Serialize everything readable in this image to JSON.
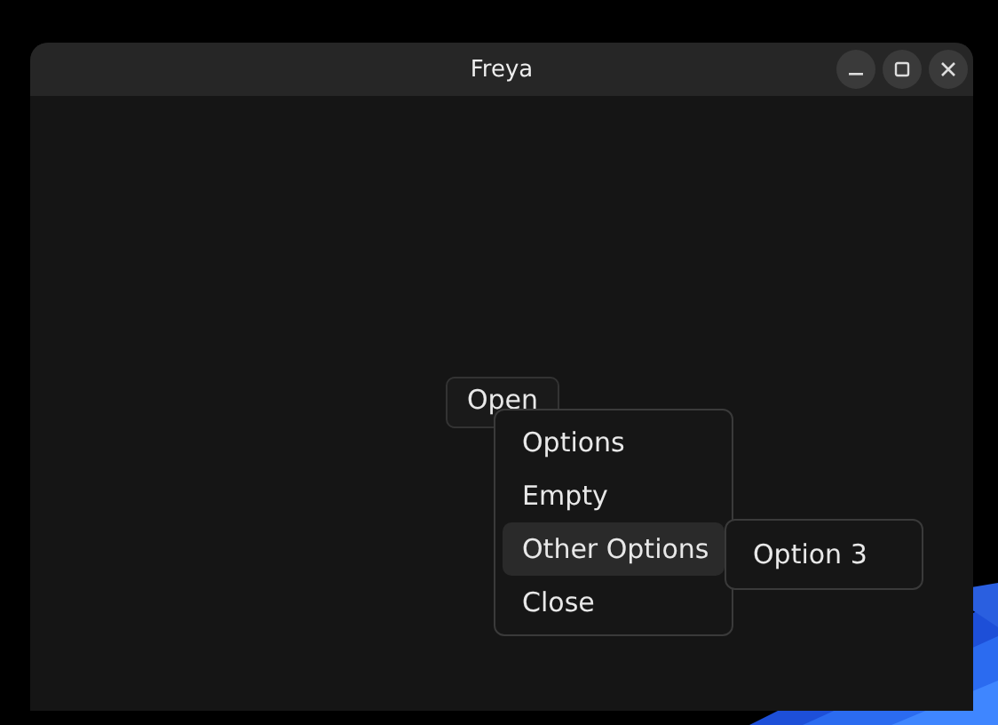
{
  "window": {
    "title": "Freya"
  },
  "open_button": {
    "label": "Open"
  },
  "menu": {
    "items": [
      {
        "label": "Options",
        "selected": false
      },
      {
        "label": "Empty",
        "selected": false
      },
      {
        "label": "Other Options",
        "selected": true
      },
      {
        "label": "Close",
        "selected": false
      }
    ]
  },
  "submenu": {
    "items": [
      {
        "label": "Option 3",
        "selected": false
      }
    ]
  }
}
